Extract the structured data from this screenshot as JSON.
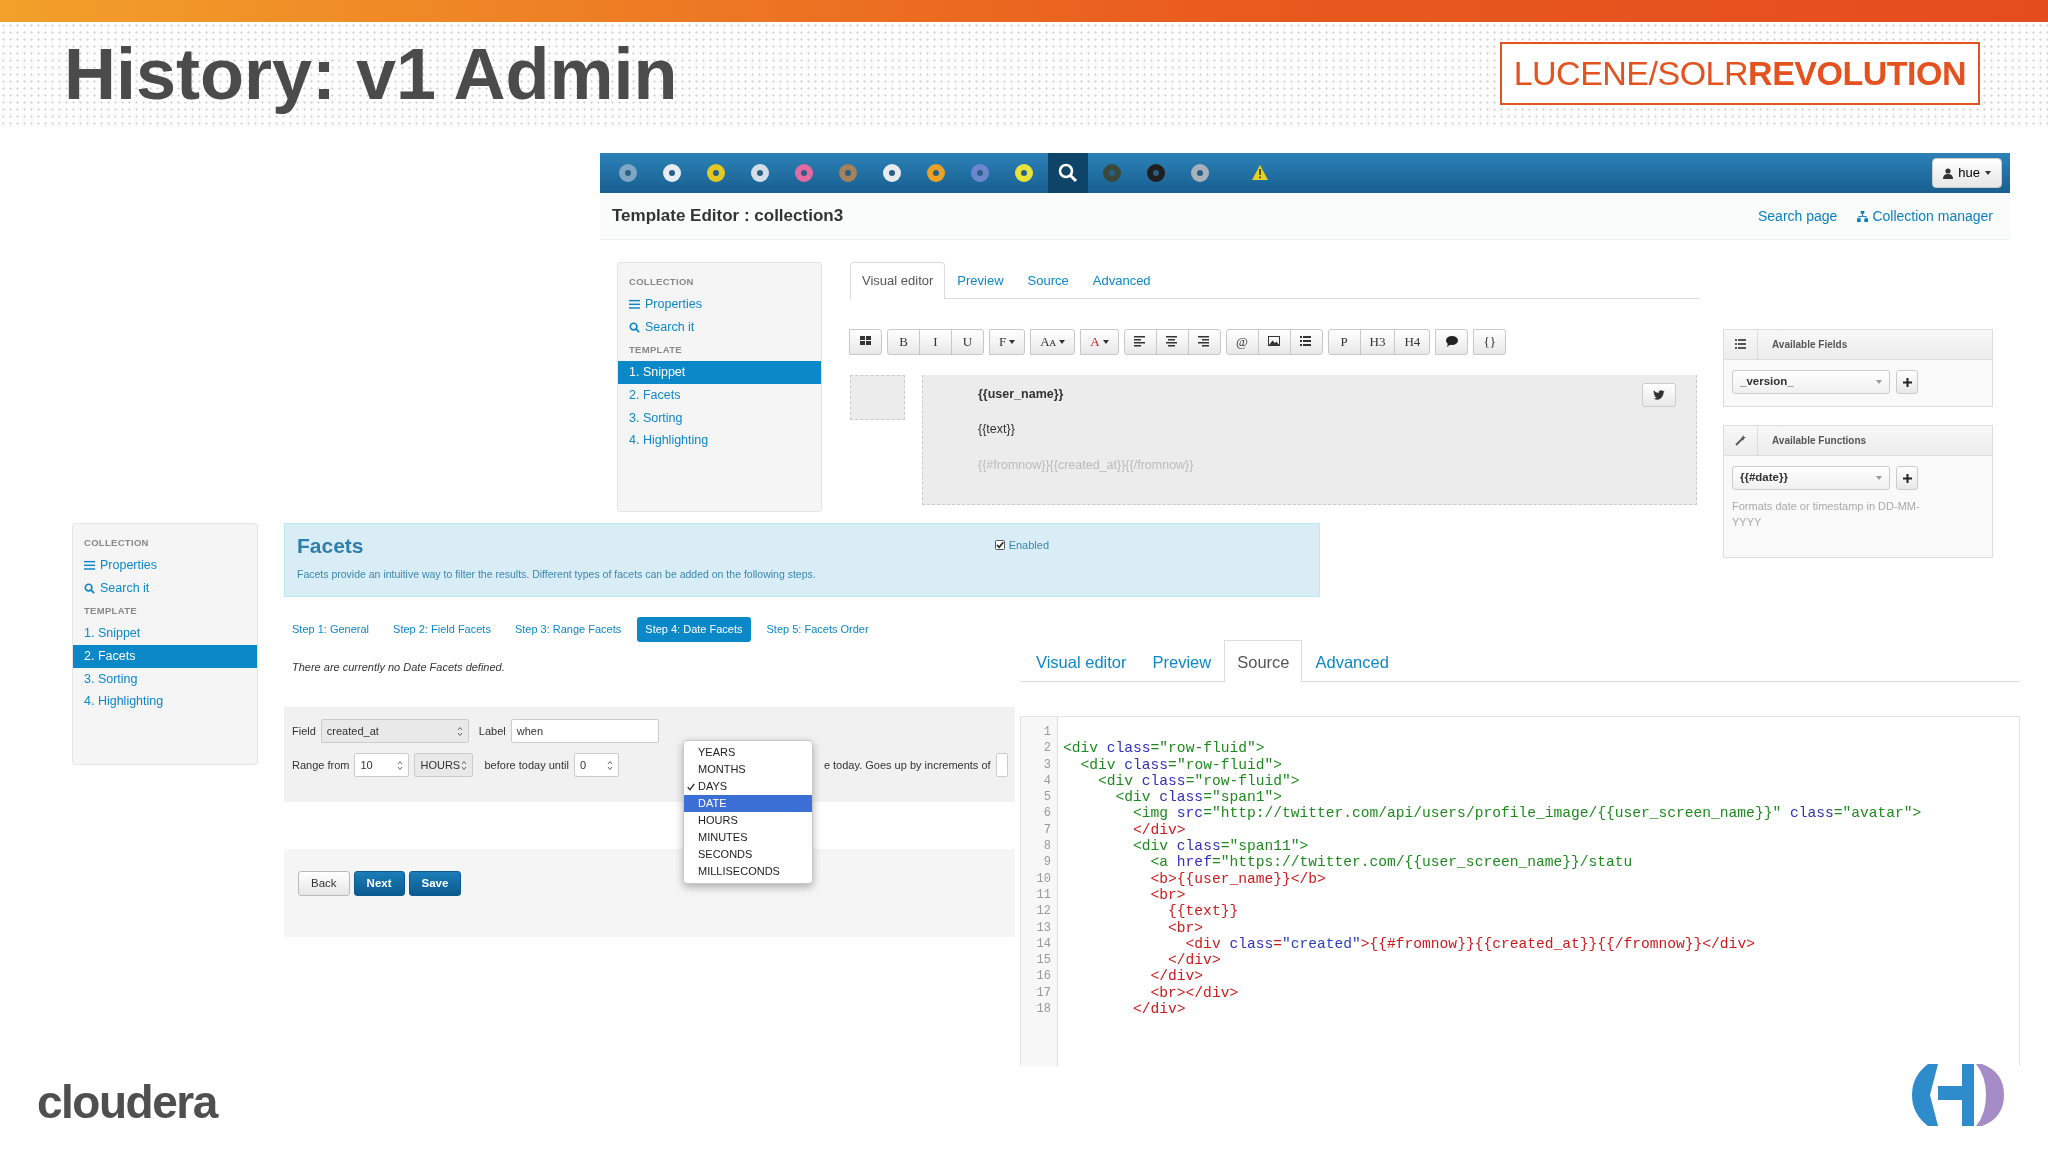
{
  "slide": {
    "title": "History: v1 Admin",
    "logo": "LUCENE/SOLR**REVOLUTION**",
    "footer_logo": "cloudera"
  },
  "editor": {
    "apps": [
      {
        "kind": "app",
        "selected": false
      },
      {
        "kind": "app",
        "selected": false
      },
      {
        "kind": "app",
        "selected": false
      },
      {
        "kind": "app",
        "selected": false
      },
      {
        "kind": "app",
        "selected": false
      },
      {
        "kind": "app",
        "selected": false
      },
      {
        "kind": "app",
        "selected": false
      },
      {
        "kind": "app",
        "selected": false
      },
      {
        "kind": "app",
        "selected": false
      },
      {
        "kind": "app",
        "selected": false
      },
      {
        "kind": "search",
        "selected": true
      },
      {
        "kind": "app",
        "selected": false
      },
      {
        "kind": "app",
        "selected": false
      },
      {
        "kind": "app",
        "selected": false
      },
      {
        "kind": "warning",
        "selected": false
      }
    ],
    "user_button": "hue",
    "page_title": "Template Editor : collection3",
    "header_links": [
      "Search page",
      "Collection manager"
    ],
    "sidebar": [
      {
        "kind": "heading",
        "label": "COLLECTION"
      },
      {
        "kind": "list-link",
        "label": "Properties"
      },
      {
        "kind": "search-link",
        "label": "Search it"
      },
      {
        "kind": "heading",
        "label": "TEMPLATE"
      },
      {
        "kind": "item",
        "label": "1. Snippet",
        "selected": true
      },
      {
        "kind": "item",
        "label": "2. Facets",
        "selected": false
      },
      {
        "kind": "item",
        "label": "3. Sorting",
        "selected": false
      },
      {
        "kind": "item",
        "label": "4. Highlighting",
        "selected": false
      }
    ],
    "tabs": [
      {
        "label": "Visual editor",
        "selected": true
      },
      {
        "label": "Preview",
        "selected": false
      },
      {
        "label": "Source",
        "selected": false
      },
      {
        "label": "Advanced",
        "selected": false
      }
    ],
    "toolbar": [
      [
        {
          "kind": "grid"
        }
      ],
      [
        {
          "kind": "text",
          "label": "B"
        },
        {
          "kind": "text",
          "label": "I"
        },
        {
          "kind": "text",
          "label": "U"
        }
      ],
      [
        {
          "kind": "text",
          "label": "F",
          "caret": true
        }
      ],
      [
        {
          "kind": "text",
          "label": "Aᴀ",
          "caret": true
        }
      ],
      [
        {
          "kind": "text",
          "label": "A",
          "caret": true,
          "color": "#cc2222"
        }
      ],
      [
        {
          "kind": "align-left"
        },
        {
          "kind": "align-center"
        },
        {
          "kind": "align-right"
        }
      ],
      [
        {
          "kind": "text",
          "label": "@"
        },
        {
          "kind": "image"
        },
        {
          "kind": "list"
        }
      ],
      [
        {
          "kind": "text",
          "label": "P"
        },
        {
          "kind": "text",
          "label": "H3"
        },
        {
          "kind": "text",
          "label": "H4"
        }
      ],
      [
        {
          "kind": "comment"
        }
      ],
      [
        {
          "kind": "text",
          "label": "{}"
        }
      ]
    ],
    "snippet": [
      {
        "kind": "bold",
        "text": "{{user_name}}"
      },
      {
        "kind": "plain",
        "text": "{{text}}"
      },
      {
        "kind": "muted",
        "text": "{{#fromnow}}{{created_at}}{{/fromnow}}"
      }
    ],
    "fields_panel": {
      "title": "Available Fields",
      "value": "_version_"
    },
    "functions_panel": {
      "title": "Available Functions",
      "value": "{{#date}}",
      "help": "Formats date or timestamp in DD-MM-YYYY"
    }
  },
  "facets": {
    "sidebar": [
      {
        "kind": "heading",
        "label": "COLLECTION"
      },
      {
        "kind": "list-link",
        "label": "Properties"
      },
      {
        "kind": "search-link",
        "label": "Search it"
      },
      {
        "kind": "heading",
        "label": "TEMPLATE"
      },
      {
        "kind": "item",
        "label": "1. Snippet",
        "selected": false
      },
      {
        "kind": "item",
        "label": "2. Facets",
        "selected": true
      },
      {
        "kind": "item",
        "label": "3. Sorting",
        "selected": false
      },
      {
        "kind": "item",
        "label": "4. Highlighting",
        "selected": false
      }
    ],
    "title": "Facets",
    "description": "Facets provide an intuitive way to filter the results. Different types of facets can be added on the following steps.",
    "enabled": {
      "label": "Enabled",
      "checked": true
    },
    "steps": [
      {
        "label": "Step 1: General",
        "selected": false
      },
      {
        "label": "Step 2: Field Facets",
        "selected": false
      },
      {
        "label": "Step 3: Range Facets",
        "selected": false
      },
      {
        "label": "Step 4: Date Facets",
        "selected": true
      },
      {
        "label": "Step 5: Facets Order",
        "selected": false
      }
    ],
    "notice": "There are currently no Date Facets defined.",
    "form": {
      "field_label": "Field",
      "field_value": "created_at",
      "label_label": "Label",
      "label_value": "when",
      "range_label": "Range from",
      "from_value": "10",
      "unit": "HOURS",
      "until_label": "before today until",
      "until_value": "0",
      "trailing": "e today. Goes up by increments of"
    },
    "menu": [
      {
        "label": "YEARS",
        "checked": false,
        "selected": false
      },
      {
        "label": "MONTHS",
        "checked": false,
        "selected": false
      },
      {
        "label": "DAYS",
        "checked": true,
        "selected": false
      },
      {
        "label": "DATE",
        "checked": false,
        "selected": true
      },
      {
        "label": "HOURS",
        "checked": false,
        "selected": false
      },
      {
        "label": "MINUTES",
        "checked": false,
        "selected": false
      },
      {
        "label": "SECONDS",
        "checked": false,
        "selected": false
      },
      {
        "label": "MILLISECONDS",
        "checked": false,
        "selected": false
      }
    ],
    "buttons": [
      {
        "label": "Back",
        "kind": "default"
      },
      {
        "label": "Next",
        "kind": "primary"
      },
      {
        "label": "Save",
        "kind": "primary"
      }
    ]
  },
  "source": {
    "tabs": [
      {
        "label": "Visual editor",
        "selected": false
      },
      {
        "label": "Preview",
        "selected": false
      },
      {
        "label": "Source",
        "selected": true
      },
      {
        "label": "Advanced",
        "selected": false
      }
    ],
    "lines": [
      {
        "number": "1"
      },
      {
        "number": "2",
        "text": "<div class=\"row-fluid\">",
        "color": "#1e8a1e"
      },
      {
        "number": "3",
        "text": "  <div class=\"row-fluid\">",
        "color": "#1e8a1e"
      },
      {
        "number": "4",
        "text": "    <div class=\"row-fluid\">",
        "color": "#1e8a1e"
      },
      {
        "number": "5",
        "text": "      <div class=\"span1\">",
        "color": "#1e8a1e"
      },
      {
        "number": "6",
        "text": "        <img src=\"http://twitter.com/api/users/profile_image/{{user_screen_name}}\" class=\"avatar\">",
        "color": "#1e8a1e"
      },
      {
        "number": "7",
        "text": "        </div>",
        "color": "#cc1a1a"
      },
      {
        "number": "8",
        "text": "        <div class=\"span11\">",
        "color": "#1e8a1e"
      },
      {
        "number": "9",
        "text": "          <a href=\"https://twitter.com/{{user_screen_name}}/statu",
        "color": "#1e8a1e"
      },
      {
        "number": "10",
        "text": "          <b>{{user_name}}</b>",
        "color": "#cc1a1a"
      },
      {
        "number": "11",
        "text": "          <br>",
        "color": "#cc1a1a"
      },
      {
        "number": "12",
        "text": "            {{text}}",
        "color": "#cc1a1a"
      },
      {
        "number": "13",
        "text": "            <br>",
        "color": "#cc1a1a"
      },
      {
        "number": "14",
        "text": "              <div class=\"created\">{{#fromnow}}{{created_at}}{{/fromnow}}</div>",
        "color": "#cc1a1a"
      },
      {
        "number": "15",
        "text": "            </div>",
        "color": "#cc1a1a"
      },
      {
        "number": "16",
        "text": "          </div>",
        "color": "#cc1a1a"
      },
      {
        "number": "17",
        "text": "          <br></div>",
        "color": "#cc1a1a"
      },
      {
        "number": "18",
        "text": "        </div>",
        "color": "#cc1a1a"
      }
    ]
  }
}
